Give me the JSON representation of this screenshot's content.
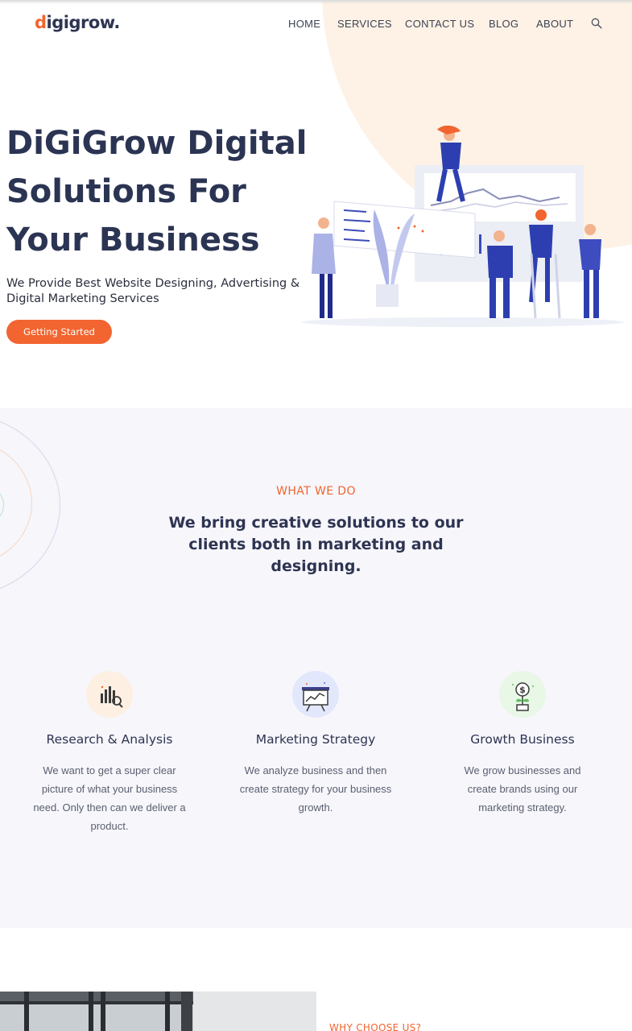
{
  "brand": {
    "logo_initial": "d",
    "logo_rest": "igigrow."
  },
  "nav": {
    "items": [
      "HOME",
      "SERVICES",
      "CONTACT US",
      "BLOG",
      "ABOUT"
    ],
    "search_icon": "search-icon"
  },
  "hero": {
    "title": "DiGiGrow Digital Solutions For Your Business",
    "subtitle": "We Provide Best Website Designing, Advertising & Digital Marketing Services",
    "cta_label": "Getting Started"
  },
  "what_we_do": {
    "eyebrow": "WHAT WE DO",
    "title": "We bring creative solutions to our clients both in marketing and designing.",
    "features": [
      {
        "icon": "chart-icon",
        "title": "Research & Analysis",
        "text": "We want to get a super clear picture of what your business need. Only then can we deliver a product."
      },
      {
        "icon": "presentation-board-icon",
        "title": "Marketing Strategy",
        "text": "We analyze business and then create strategy for your business growth."
      },
      {
        "icon": "money-plant-icon",
        "title": "Growth Business",
        "text": "We grow businesses and create brands using our marketing strategy."
      }
    ]
  },
  "why_choose": {
    "eyebrow": "WHY CHOOSE US?"
  },
  "colors": {
    "accent": "#f26430",
    "heading": "#2b3452",
    "section_bg": "#f6f6fb",
    "hero_blob": "#fdf2e5"
  }
}
